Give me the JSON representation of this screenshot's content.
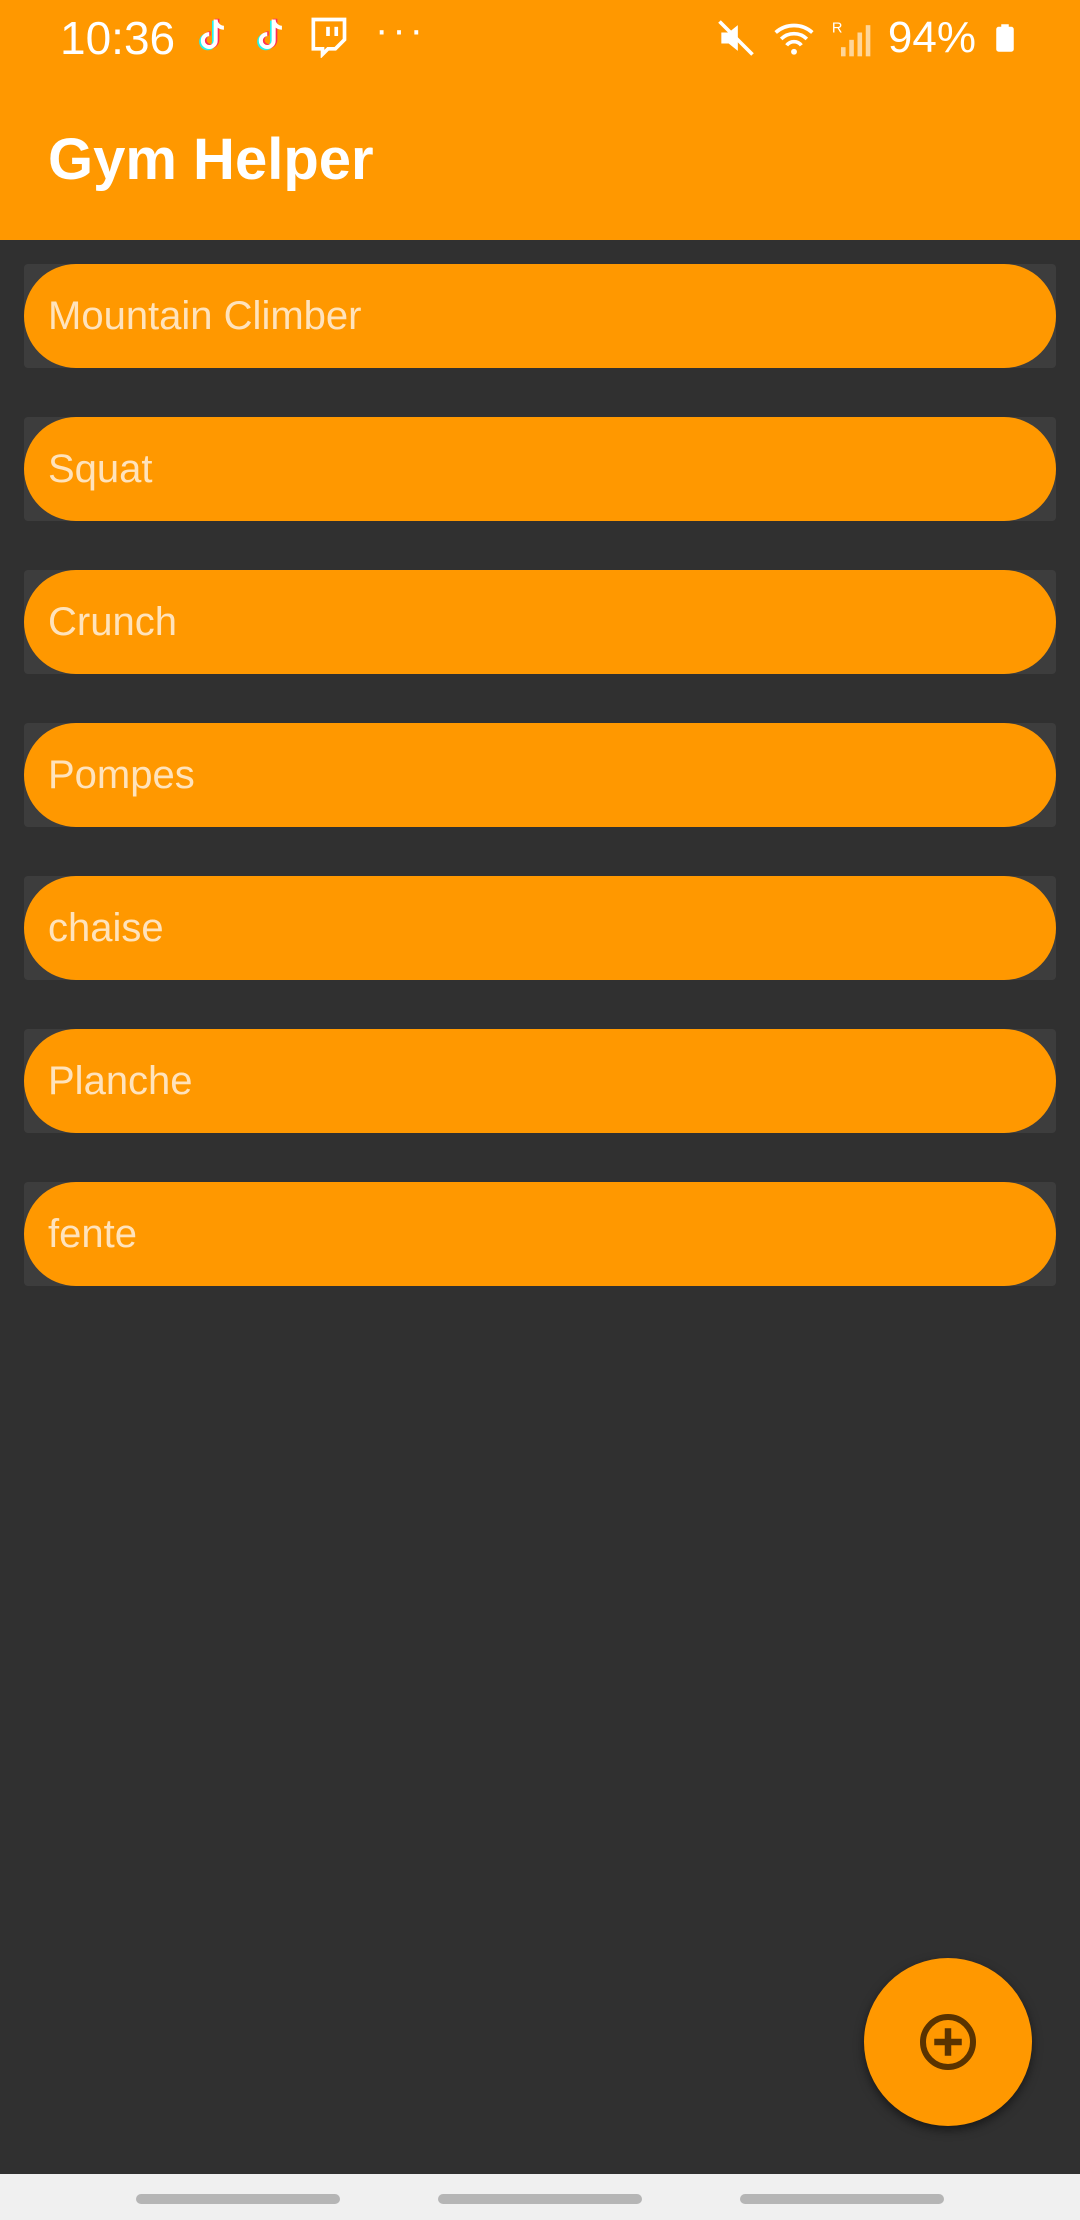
{
  "status_bar": {
    "time": "10:36",
    "battery": "94%",
    "left_icons": [
      "tiktok-icon",
      "tiktok-icon",
      "twitch-icon"
    ],
    "more": "···",
    "right_icons": [
      "mute-icon",
      "wifi-icon",
      "signal-icon",
      "battery-icon"
    ]
  },
  "app_bar": {
    "title": "Gym Helper"
  },
  "exercises": [
    {
      "label": "Mountain Climber"
    },
    {
      "label": "Squat"
    },
    {
      "label": "Crunch"
    },
    {
      "label": "Pompes"
    },
    {
      "label": "chaise"
    },
    {
      "label": "Planche"
    },
    {
      "label": "fente"
    }
  ],
  "fab": {
    "icon": "add-circle-icon"
  },
  "colors": {
    "accent": "#FF9800",
    "background": "#303030",
    "item_text": "#FFE3BC"
  }
}
